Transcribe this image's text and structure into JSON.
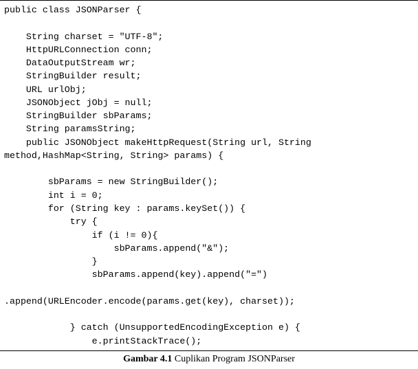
{
  "code": "public class JSONParser {\n\n    String charset = \"UTF-8\";\n    HttpURLConnection conn;\n    DataOutputStream wr;\n    StringBuilder result;\n    URL urlObj;\n    JSONObject jObj = null;\n    StringBuilder sbParams;\n    String paramsString;\n    public JSONObject makeHttpRequest(String url, String \nmethod,HashMap<String, String> params) {\n\n        sbParams = new StringBuilder();\n        int i = 0;\n        for (String key : params.keySet()) {\n            try {\n                if (i != 0){\n                    sbParams.append(\"&\");\n                }\n                sbParams.append(key).append(\"=\")\n\n.append(URLEncoder.encode(params.get(key), charset));\n\n            } catch (UnsupportedEncodingException e) {\n                e.printStackTrace();",
  "caption": {
    "label": "Gambar 4.1",
    "text": " Cuplikan Program JSONParser"
  }
}
